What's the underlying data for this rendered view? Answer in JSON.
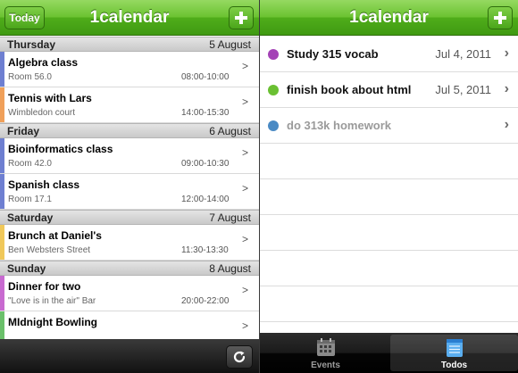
{
  "colors": {
    "navbar": "#5bb827",
    "day_header": "#d6d6d6",
    "todo_dots": [
      "#a442b6",
      "#6ac032",
      "#4a8ac4"
    ]
  },
  "calendar": {
    "title": "1calendar",
    "today_label": "Today",
    "add_label": "+",
    "days": [
      {
        "name": "Thursday",
        "date": "5 August",
        "events": [
          {
            "title": "Algebra class",
            "location": "Room 56.0",
            "time": "08:00-10:00",
            "color": "#6e7fd1"
          },
          {
            "title": "Tennis with Lars",
            "location": "Wimbledon court",
            "time": "14:00-15:30",
            "color": "#f0a05a"
          }
        ]
      },
      {
        "name": "Friday",
        "date": "6 August",
        "events": [
          {
            "title": "Bioinformatics class",
            "location": "Room 42.0",
            "time": "09:00-10:30",
            "color": "#6e7fd1"
          },
          {
            "title": "Spanish class",
            "location": "Room 17.1",
            "time": "12:00-14:00",
            "color": "#6e7fd1"
          }
        ]
      },
      {
        "name": "Saturday",
        "date": "7 August",
        "events": [
          {
            "title": "Brunch at Daniel's",
            "location": "Ben Websters Street",
            "time": "11:30-13:30",
            "color": "#f0c85a"
          }
        ]
      },
      {
        "name": "Sunday",
        "date": "8 August",
        "events": [
          {
            "title": "Dinner for two",
            "location": "\"Love is in the air\" Bar",
            "time": "20:00-22:00",
            "color": "#c86ad0"
          },
          {
            "title": "MIdnight Bowling",
            "location": "",
            "time": "",
            "color": "#6ac06a"
          }
        ]
      }
    ]
  },
  "todos": {
    "title": "1calendar",
    "add_label": "+",
    "items": [
      {
        "title": "Study 315 vocab",
        "date": "Jul 4, 2011",
        "done": false,
        "dot_color": "#a442b6"
      },
      {
        "title": "finish book about html",
        "date": "Jul 5, 2011",
        "done": false,
        "dot_color": "#6ac032"
      },
      {
        "title": "do 313k homework",
        "date": "",
        "done": true,
        "dot_color": "#4a8ac4"
      }
    ],
    "tabs": [
      {
        "label": "Events",
        "icon": "calendar-icon",
        "active": false
      },
      {
        "label": "Todos",
        "icon": "notepad-icon",
        "active": true
      }
    ]
  }
}
